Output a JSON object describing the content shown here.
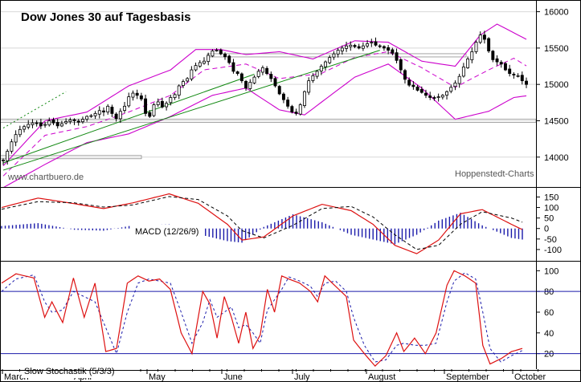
{
  "chart_data": [
    {
      "type": "candlestick",
      "title": "Dow Jones 30 auf Tagesbasis",
      "source_left": "www.chartbuero.de",
      "source_right": "Hoppenstedt-Charts",
      "ylim": [
        13600,
        16150
      ],
      "yticks": [
        14000,
        14500,
        15000,
        15500,
        16000
      ],
      "months": [
        "March",
        "April",
        "May",
        "June",
        "July",
        "August",
        "September",
        "October"
      ],
      "close": [
        13960,
        14080,
        14210,
        14310,
        14380,
        14420,
        14450,
        14470,
        14460,
        14430,
        14450,
        14500,
        14470,
        14430,
        14460,
        14490,
        14510,
        14500,
        14480,
        14520,
        14560,
        14570,
        14600,
        14640,
        14620,
        14700,
        14600,
        14530,
        14630,
        14700,
        14830,
        14880,
        14850,
        14800,
        14600,
        14560,
        14720,
        14760,
        14690,
        14740,
        14820,
        14860,
        14980,
        15040,
        15080,
        15200,
        15260,
        15300,
        15320,
        15400,
        15460,
        15470,
        15420,
        15380,
        15300,
        15180,
        15150,
        15050,
        14950,
        15030,
        15100,
        15180,
        15230,
        15150,
        15080,
        14980,
        14870,
        14790,
        14700,
        14620,
        14600,
        14720,
        14900,
        15050,
        15120,
        15180,
        15250,
        15310,
        15370,
        15420,
        15470,
        15500,
        15530,
        15540,
        15520,
        15500,
        15530,
        15560,
        15580,
        15540,
        15520,
        15500,
        15470,
        15430,
        15330,
        15200,
        15070,
        14990,
        14970,
        14920,
        14890,
        14850,
        14820,
        14810,
        14830,
        14850,
        14900,
        14960,
        15020,
        15110,
        15240,
        15350,
        15450,
        15580,
        15680,
        15620,
        15460,
        15340,
        15310,
        15280,
        15200,
        15150,
        15130,
        15120,
        15050,
        15000
      ],
      "bands": {
        "upper_anchors": [
          [
            0,
            13880
          ],
          [
            10,
            14500
          ],
          [
            20,
            14620
          ],
          [
            30,
            14980
          ],
          [
            40,
            15200
          ],
          [
            46,
            15480
          ],
          [
            52,
            15480
          ],
          [
            58,
            15410
          ],
          [
            66,
            15450
          ],
          [
            74,
            15350
          ],
          [
            84,
            15600
          ],
          [
            92,
            15580
          ],
          [
            100,
            15320
          ],
          [
            108,
            15250
          ],
          [
            114,
            15680
          ],
          [
            118,
            15830
          ],
          [
            126,
            15590
          ]
        ],
        "middle_anchors": [
          [
            0,
            13740
          ],
          [
            10,
            14300
          ],
          [
            20,
            14420
          ],
          [
            30,
            14620
          ],
          [
            40,
            14850
          ],
          [
            48,
            15200
          ],
          [
            58,
            15280
          ],
          [
            66,
            15080
          ],
          [
            76,
            15150
          ],
          [
            84,
            15370
          ],
          [
            92,
            15450
          ],
          [
            100,
            15230
          ],
          [
            108,
            14960
          ],
          [
            116,
            15200
          ],
          [
            122,
            15360
          ],
          [
            126,
            15220
          ]
        ],
        "lower_anchors": [
          [
            0,
            13580
          ],
          [
            10,
            13900
          ],
          [
            20,
            14200
          ],
          [
            30,
            14320
          ],
          [
            40,
            14560
          ],
          [
            50,
            14850
          ],
          [
            58,
            14950
          ],
          [
            66,
            14650
          ],
          [
            72,
            14580
          ],
          [
            84,
            15100
          ],
          [
            92,
            15280
          ],
          [
            100,
            14950
          ],
          [
            108,
            14520
          ],
          [
            116,
            14630
          ],
          [
            122,
            14820
          ],
          [
            126,
            14850
          ]
        ]
      },
      "trendlines": [
        {
          "from": [
            0,
            13920
          ],
          "to": [
            60,
            15140
          ]
        },
        {
          "from": [
            0,
            13820
          ],
          "to": [
            90,
            15470
          ]
        }
      ],
      "horizontal_lines": [
        14000,
        14500,
        15400
      ],
      "dotted_lines": [
        {
          "from": [
            0,
            14400
          ],
          "to": [
            15,
            14900
          ]
        }
      ]
    },
    {
      "type": "line",
      "title": "MACD (12/26/9)",
      "ylim": [
        -150,
        190
      ],
      "yticks": [
        150,
        100,
        50,
        0,
        -50,
        -100
      ],
      "macd_anchors": [
        [
          0,
          100
        ],
        [
          10,
          145
        ],
        [
          20,
          118
        ],
        [
          28,
          95
        ],
        [
          36,
          122
        ],
        [
          46,
          165
        ],
        [
          54,
          120
        ],
        [
          62,
          20
        ],
        [
          66,
          -55
        ],
        [
          72,
          -40
        ],
        [
          80,
          60
        ],
        [
          88,
          115
        ],
        [
          96,
          85
        ],
        [
          102,
          20
        ],
        [
          108,
          -80
        ],
        [
          114,
          -120
        ],
        [
          120,
          -55
        ],
        [
          126,
          70
        ],
        [
          132,
          90
        ],
        [
          140,
          20
        ],
        [
          143,
          -5
        ]
      ],
      "signal_anchors": [
        [
          0,
          92
        ],
        [
          10,
          128
        ],
        [
          20,
          122
        ],
        [
          28,
          102
        ],
        [
          36,
          112
        ],
        [
          46,
          152
        ],
        [
          54,
          138
        ],
        [
          62,
          60
        ],
        [
          66,
          -10
        ],
        [
          72,
          -45
        ],
        [
          80,
          15
        ],
        [
          88,
          95
        ],
        [
          96,
          105
        ],
        [
          102,
          55
        ],
        [
          108,
          -30
        ],
        [
          114,
          -100
        ],
        [
          120,
          -80
        ],
        [
          126,
          20
        ],
        [
          132,
          80
        ],
        [
          140,
          50
        ],
        [
          143,
          30
        ]
      ]
    },
    {
      "type": "line",
      "title": "Slow Stochastik (5/3/3)",
      "ylim": [
        5,
        108
      ],
      "yticks": [
        100,
        80,
        60,
        40,
        20
      ],
      "reference_lines": [
        80,
        20
      ],
      "k_anchors": [
        [
          0,
          88
        ],
        [
          4,
          97
        ],
        [
          9,
          93
        ],
        [
          12,
          55
        ],
        [
          14,
          70
        ],
        [
          17,
          50
        ],
        [
          20,
          93
        ],
        [
          23,
          55
        ],
        [
          26,
          88
        ],
        [
          29,
          22
        ],
        [
          32,
          25
        ],
        [
          35,
          88
        ],
        [
          38,
          95
        ],
        [
          41,
          90
        ],
        [
          44,
          92
        ],
        [
          47,
          82
        ],
        [
          50,
          40
        ],
        [
          53,
          20
        ],
        [
          56,
          80
        ],
        [
          58,
          68
        ],
        [
          60,
          35
        ],
        [
          62,
          75
        ],
        [
          64,
          55
        ],
        [
          66,
          30
        ],
        [
          68,
          60
        ],
        [
          70,
          25
        ],
        [
          72,
          38
        ],
        [
          74,
          82
        ],
        [
          76,
          60
        ],
        [
          78,
          95
        ],
        [
          80,
          92
        ],
        [
          83,
          88
        ],
        [
          86,
          80
        ],
        [
          88,
          70
        ],
        [
          90,
          95
        ],
        [
          93,
          85
        ],
        [
          96,
          75
        ],
        [
          98,
          33
        ],
        [
          101,
          20
        ],
        [
          104,
          8
        ],
        [
          107,
          18
        ],
        [
          110,
          40
        ],
        [
          112,
          22
        ],
        [
          115,
          35
        ],
        [
          118,
          20
        ],
        [
          121,
          40
        ],
        [
          124,
          86
        ],
        [
          126,
          100
        ],
        [
          129,
          95
        ],
        [
          132,
          88
        ],
        [
          134,
          28
        ],
        [
          136,
          10
        ],
        [
          139,
          15
        ],
        [
          142,
          22
        ],
        [
          145,
          25
        ]
      ],
      "d_anchors": [
        [
          0,
          80
        ],
        [
          4,
          92
        ],
        [
          9,
          96
        ],
        [
          12,
          70
        ],
        [
          14,
          60
        ],
        [
          17,
          62
        ],
        [
          20,
          80
        ],
        [
          23,
          75
        ],
        [
          26,
          70
        ],
        [
          29,
          45
        ],
        [
          32,
          20
        ],
        [
          35,
          60
        ],
        [
          38,
          88
        ],
        [
          41,
          92
        ],
        [
          44,
          90
        ],
        [
          47,
          88
        ],
        [
          50,
          60
        ],
        [
          53,
          30
        ],
        [
          56,
          50
        ],
        [
          58,
          72
        ],
        [
          60,
          55
        ],
        [
          62,
          60
        ],
        [
          64,
          65
        ],
        [
          66,
          45
        ],
        [
          68,
          48
        ],
        [
          70,
          40
        ],
        [
          72,
          30
        ],
        [
          74,
          62
        ],
        [
          76,
          72
        ],
        [
          78,
          82
        ],
        [
          80,
          94
        ],
        [
          83,
          90
        ],
        [
          86,
          85
        ],
        [
          88,
          75
        ],
        [
          90,
          88
        ],
        [
          93,
          90
        ],
        [
          96,
          80
        ],
        [
          98,
          55
        ],
        [
          101,
          28
        ],
        [
          104,
          12
        ],
        [
          107,
          14
        ],
        [
          110,
          28
        ],
        [
          112,
          30
        ],
        [
          115,
          28
        ],
        [
          118,
          28
        ],
        [
          121,
          30
        ],
        [
          124,
          70
        ],
        [
          126,
          90
        ],
        [
          129,
          98
        ],
        [
          132,
          92
        ],
        [
          134,
          60
        ],
        [
          136,
          25
        ],
        [
          139,
          12
        ],
        [
          142,
          18
        ],
        [
          145,
          23
        ]
      ]
    }
  ]
}
